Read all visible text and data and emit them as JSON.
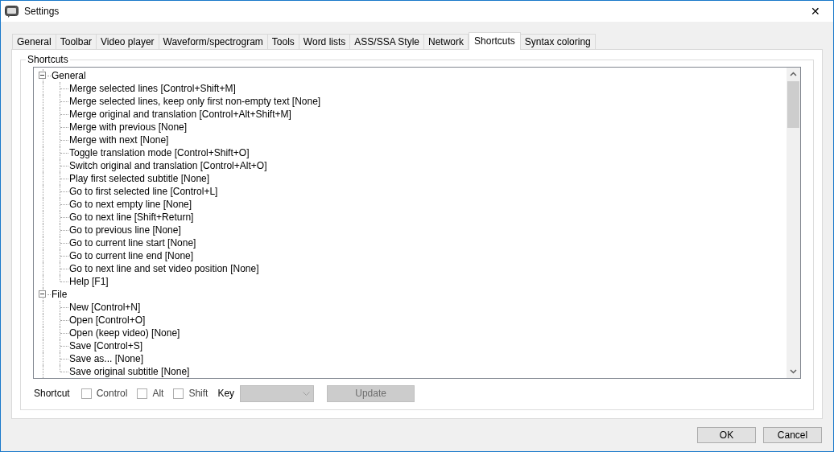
{
  "window": {
    "title": "Settings",
    "close": "✕"
  },
  "tabs": [
    {
      "label": "General",
      "selected": false
    },
    {
      "label": "Toolbar",
      "selected": false
    },
    {
      "label": "Video player",
      "selected": false
    },
    {
      "label": "Waveform/spectrogram",
      "selected": false
    },
    {
      "label": "Tools",
      "selected": false
    },
    {
      "label": "Word lists",
      "selected": false
    },
    {
      "label": "ASS/SSA Style",
      "selected": false
    },
    {
      "label": "Network",
      "selected": false
    },
    {
      "label": "Shortcuts",
      "selected": true
    },
    {
      "label": "Syntax coloring",
      "selected": false
    }
  ],
  "group": {
    "title": "Shortcuts"
  },
  "tree": [
    {
      "label": "General",
      "expanded": true,
      "children": [
        {
          "label": "Merge selected lines [Control+Shift+M]"
        },
        {
          "label": "Merge selected lines, keep only first non-empty text [None]"
        },
        {
          "label": "Merge original and translation [Control+Alt+Shift+M]"
        },
        {
          "label": "Merge with previous [None]"
        },
        {
          "label": "Merge with next [None]"
        },
        {
          "label": "Toggle translation mode [Control+Shift+O]"
        },
        {
          "label": "Switch original and translation [Control+Alt+O]"
        },
        {
          "label": "Play first selected subtitle [None]"
        },
        {
          "label": "Go to first selected line [Control+L]"
        },
        {
          "label": "Go to next empty line [None]"
        },
        {
          "label": "Go to next line [Shift+Return]"
        },
        {
          "label": "Go to previous line [None]"
        },
        {
          "label": "Go to current line start [None]"
        },
        {
          "label": "Go to current line end [None]"
        },
        {
          "label": "Go to next line and set video position [None]"
        },
        {
          "label": "Help [F1]"
        }
      ]
    },
    {
      "label": "File",
      "expanded": true,
      "children": [
        {
          "label": "New [Control+N]"
        },
        {
          "label": "Open [Control+O]"
        },
        {
          "label": "Open (keep video) [None]"
        },
        {
          "label": "Save [Control+S]"
        },
        {
          "label": "Save as... [None]"
        },
        {
          "label": "Save original subtitle [None]"
        }
      ]
    }
  ],
  "shortcut": {
    "label": "Shortcut",
    "modifiers": [
      {
        "label": "Control",
        "checked": false
      },
      {
        "label": "Alt",
        "checked": false
      },
      {
        "label": "Shift",
        "checked": false
      }
    ],
    "key_label": "Key",
    "key_dropdown": {
      "disabled": true
    },
    "update_button": {
      "label": "Update",
      "disabled": true
    }
  },
  "buttons": [
    "OK",
    "Cancel"
  ]
}
